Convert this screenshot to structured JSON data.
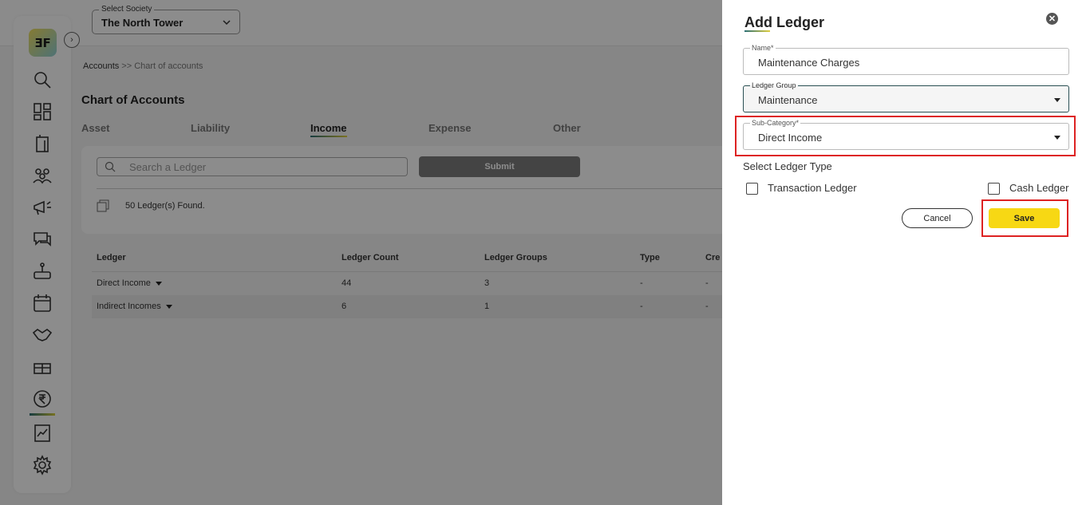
{
  "header": {
    "society_label": "Select Society",
    "society_value": "The North Tower"
  },
  "sidebar": {
    "logo_text": "ƎF",
    "items": [
      "search-icon",
      "dashboard-icon",
      "building-icon",
      "people-icon",
      "megaphone-icon",
      "chat-icon",
      "service-icon",
      "calendar-icon",
      "handshake-icon",
      "gift-icon",
      "rupee-icon",
      "report-icon",
      "gear-icon"
    ],
    "active_item": "rupee-icon"
  },
  "breadcrumb": {
    "link": "Accounts",
    "separator": " >> ",
    "current": "Chart of accounts"
  },
  "page_title": "Chart of Accounts",
  "tabs": [
    {
      "label": "Asset"
    },
    {
      "label": "Liability"
    },
    {
      "label": "Income",
      "active": true
    },
    {
      "label": "Expense"
    },
    {
      "label": "Other"
    }
  ],
  "search": {
    "placeholder": "Search a Ledger",
    "submit_label": "Submit",
    "found_text": "50 Ledger(s) Found."
  },
  "table": {
    "headers": [
      "Ledger",
      "Ledger Count",
      "Ledger Groups",
      "Type",
      "Cre"
    ],
    "rows": [
      [
        "Direct Income",
        "44",
        "3",
        "-",
        "-"
      ],
      [
        "Indirect Incomes",
        "6",
        "1",
        "-",
        "-"
      ]
    ]
  },
  "drawer": {
    "title": "Add Ledger",
    "name": {
      "label": "Name*",
      "value": "Maintenance Charges"
    },
    "ledger_group": {
      "label": "Ledger Group",
      "value": "Maintenance"
    },
    "sub_category": {
      "label": "Sub-Category*",
      "value": "Direct Income"
    },
    "ledger_type_label": "Select Ledger Type",
    "transaction_ledger": "Transaction Ledger",
    "cash_ledger": "Cash Ledger",
    "cancel_label": "Cancel",
    "save_label": "Save"
  },
  "colors": {
    "accent_yellow": "#f7d814",
    "highlight_red": "#dd2222",
    "overlay": "rgba(0,0,0,0.45)"
  }
}
